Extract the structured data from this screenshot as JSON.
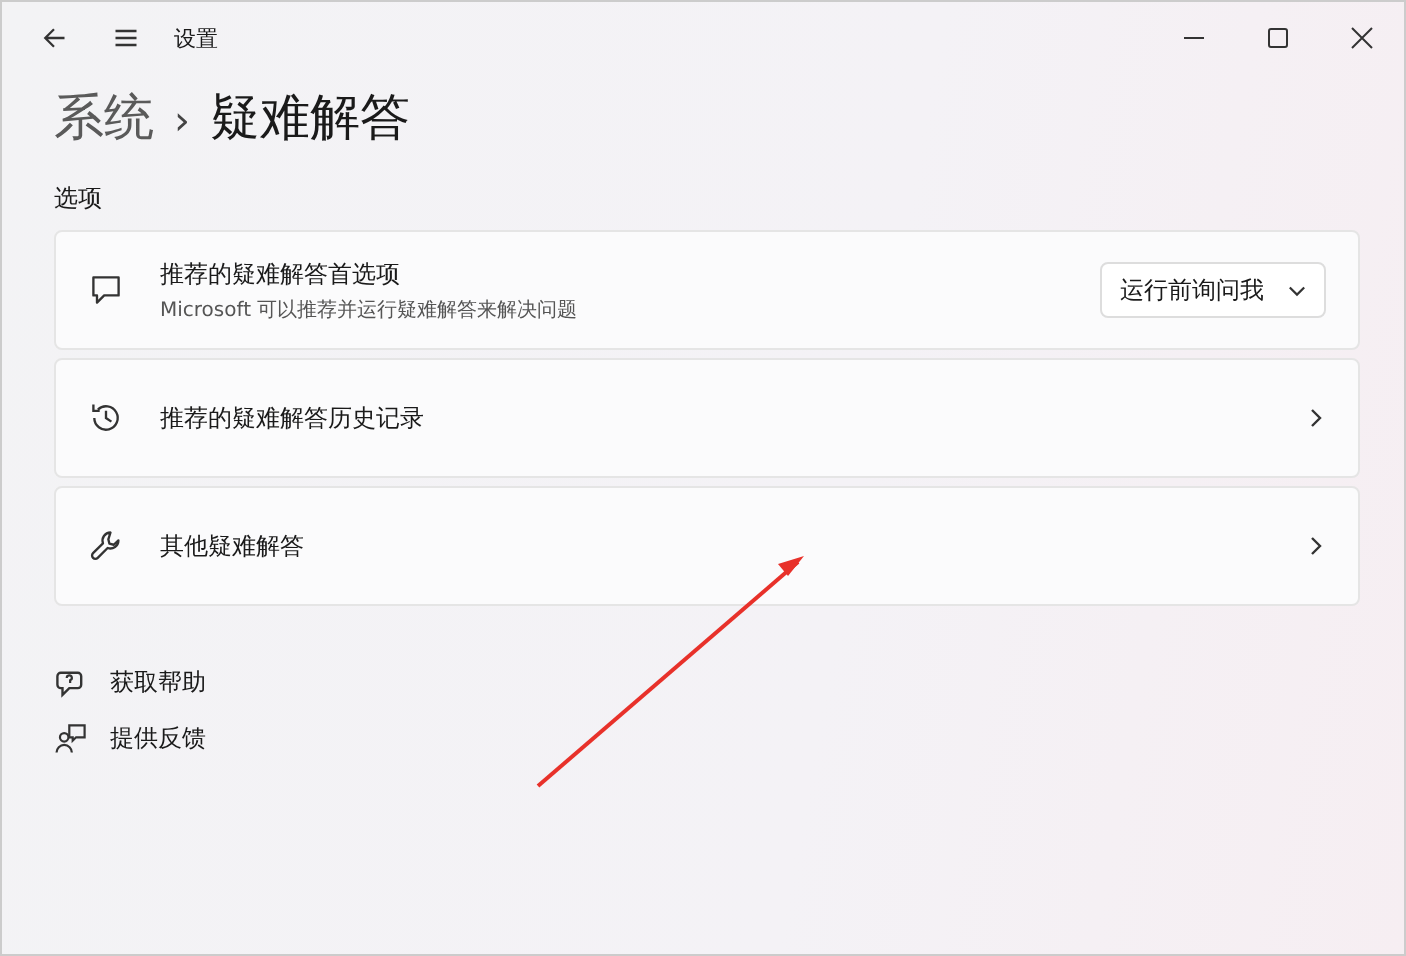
{
  "window": {
    "title": "设置"
  },
  "breadcrumb": {
    "parent": "系统",
    "separator": "›",
    "current": "疑难解答"
  },
  "section_title": "选项",
  "cards": [
    {
      "kind": "dropdown",
      "title": "推荐的疑难解答首选项",
      "subtitle": "Microsoft 可以推荐并运行疑难解答来解决问题",
      "value": "运行前询问我"
    },
    {
      "kind": "link",
      "title": "推荐的疑难解答历史记录"
    },
    {
      "kind": "link",
      "title": "其他疑难解答"
    }
  ],
  "links": [
    {
      "label": "获取帮助"
    },
    {
      "label": "提供反馈"
    }
  ],
  "annotation": {
    "kind": "arrow"
  }
}
